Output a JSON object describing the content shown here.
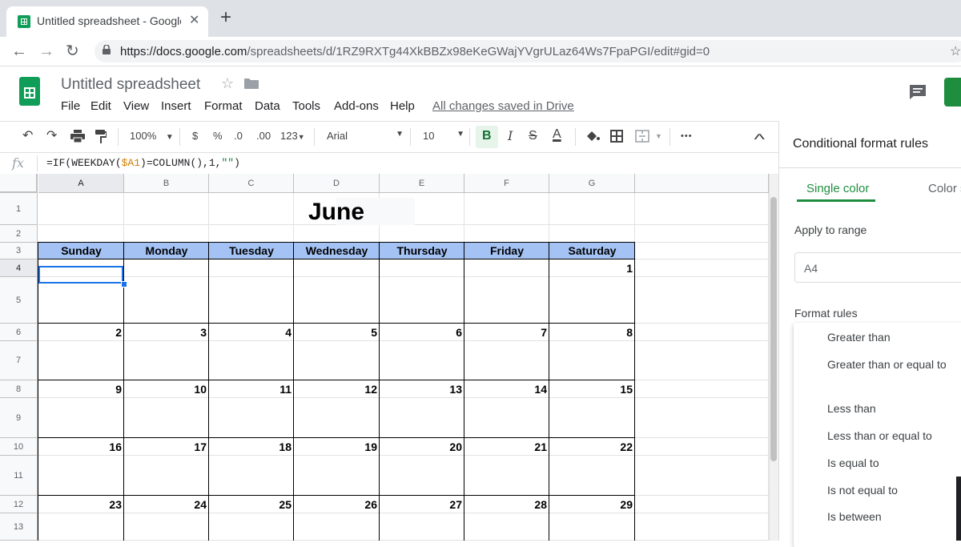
{
  "browser": {
    "tab_title": "Untitled spreadsheet - Google Sheets",
    "tab_close": "✕",
    "new_tab": "+",
    "url_host": "https://docs.google.com",
    "url_path": "/spreadsheets/d/1RZ9RXTg44XkBBZx98eKeGWajYVgrULaz64Ws7FpaPGI/edit#gid=0"
  },
  "sheets": {
    "doc_title": "Untitled spreadsheet",
    "menu": [
      "File",
      "Edit",
      "View",
      "Insert",
      "Format",
      "Data",
      "Tools",
      "Add-ons",
      "Help"
    ],
    "saved_status": "All changes saved in Drive"
  },
  "toolbar": {
    "zoom": "100%",
    "currency": "$",
    "percent": "%",
    "decrease_decimal": ".0",
    "increase_decimal": ".00",
    "more_formats": "123",
    "font": "Arial",
    "font_size": "10",
    "bold": "B",
    "italic": "I",
    "strike": "S",
    "text_color": "A",
    "more": "•••",
    "collapse": "^"
  },
  "formula_bar": {
    "fx": "fx",
    "formula_pre": "=IF(WEEKDAY(",
    "formula_ref": "$A1",
    "formula_mid": ")=COLUMN(),1,",
    "formula_str": "\"\"",
    "formula_post": ")"
  },
  "grid": {
    "columns": [
      "A",
      "B",
      "C",
      "D",
      "E",
      "F",
      "G"
    ],
    "rows": [
      "1",
      "2",
      "3",
      "4",
      "5",
      "6",
      "7",
      "8",
      "9",
      "10",
      "11",
      "12",
      "13"
    ],
    "title": "June",
    "day_headers": [
      "Sunday",
      "Monday",
      "Tuesday",
      "Wednesday",
      "Thursday",
      "Friday",
      "Saturday"
    ],
    "weeks": [
      [
        "",
        "",
        "",
        "",
        "",
        "",
        "1"
      ],
      [
        "2",
        "3",
        "4",
        "5",
        "6",
        "7",
        "8"
      ],
      [
        "9",
        "10",
        "11",
        "12",
        "13",
        "14",
        "15"
      ],
      [
        "16",
        "17",
        "18",
        "19",
        "20",
        "21",
        "22"
      ],
      [
        "23",
        "24",
        "25",
        "26",
        "27",
        "28",
        "29"
      ]
    ]
  },
  "panel": {
    "title": "Conditional format rules",
    "tab_single": "Single color",
    "tab_scale": "Color scale",
    "apply_range_label": "Apply to range",
    "range_value": "A4",
    "format_rules_label": "Format rules",
    "options": [
      "Greater than",
      "Greater than or equal to",
      "Less than",
      "Less than or equal to",
      "Is equal to",
      "Is not equal to",
      "Is between"
    ]
  },
  "colors": {
    "header_fill": "#a4c2f4",
    "accent_green": "#1e8e3e",
    "selection_blue": "#1a73e8",
    "formula_ref": "#d17c00"
  }
}
